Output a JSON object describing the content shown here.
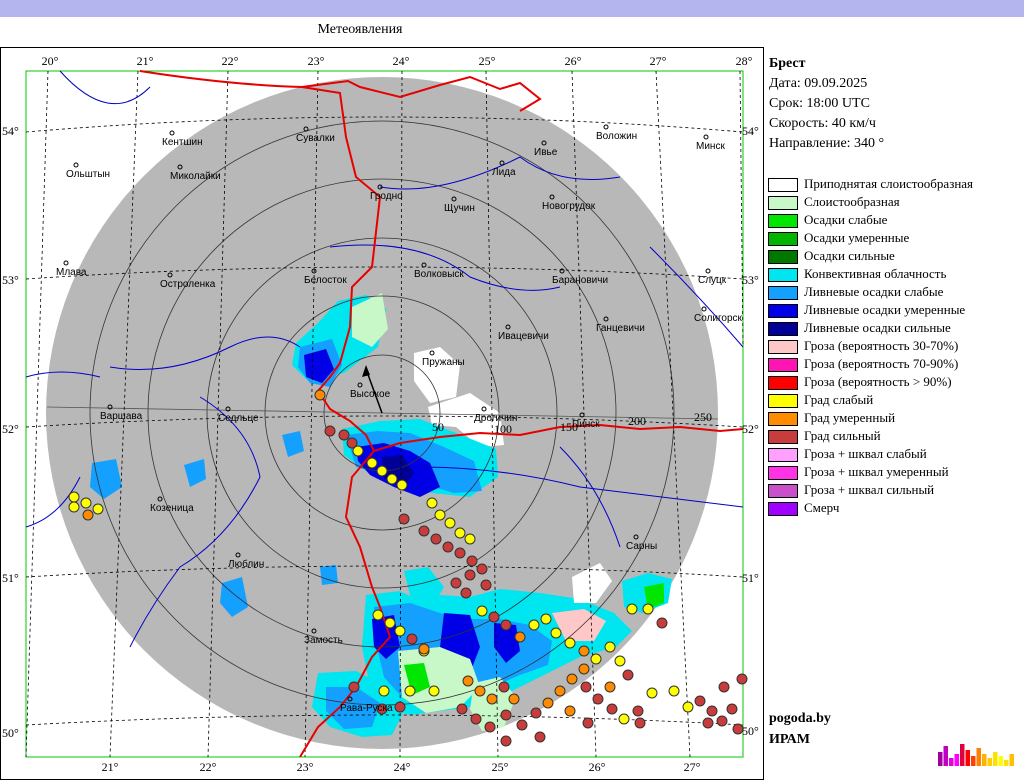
{
  "header": {
    "title": "Метеоявления"
  },
  "info": {
    "station": "Брест",
    "date": "Дата: 09.09.2025",
    "time": "Срок: 18:00 UTC",
    "speed": "Скорость: 40  км/ч",
    "direction": "Направление: 340 °"
  },
  "legend": [
    {
      "label": "Приподнятая слоистообразная",
      "color": "#ffffff"
    },
    {
      "label": "Слоистообразная",
      "color": "#c8f7c8"
    },
    {
      "label": "Осадки слабые",
      "color": "#00e600"
    },
    {
      "label": "Осадки умеренные",
      "color": "#00b400"
    },
    {
      "label": "Осадки сильные",
      "color": "#007800"
    },
    {
      "label": "Конвективная облачность",
      "color": "#00e6f0"
    },
    {
      "label": "Ливневые осадки слабые",
      "color": "#14a0ff"
    },
    {
      "label": "Ливневые осадки умеренные",
      "color": "#0000e6"
    },
    {
      "label": "Ливневые осадки сильные",
      "color": "#000096"
    },
    {
      "label": "Гроза (вероятность 30-70%)",
      "color": "#ffc8c8"
    },
    {
      "label": "Гроза (вероятность 70-90%)",
      "color": "#ff14b4"
    },
    {
      "label": "Гроза (вероятность > 90%)",
      "color": "#ff0000"
    },
    {
      "label": "Град слабый",
      "color": "#ffff00"
    },
    {
      "label": "Град умеренный",
      "color": "#ff8c00"
    },
    {
      "label": "Град сильный",
      "color": "#c83c3c"
    },
    {
      "label": "Гроза + шквал слабый",
      "color": "#ffa0ff"
    },
    {
      "label": "Гроза + шквал умеренный",
      "color": "#ff32e6"
    },
    {
      "label": "Гроза + шквал сильный",
      "color": "#c850c8"
    },
    {
      "label": "Смерч",
      "color": "#a000ff"
    }
  ],
  "credits": {
    "site": "pogoda.by",
    "org": "ИРАМ"
  },
  "map": {
    "lon_labels_top": [
      "20°",
      "21°",
      "22°",
      "23°",
      "24°",
      "25°",
      "26°",
      "27°",
      "28°"
    ],
    "lon_labels_bottom": [
      "21°",
      "22°",
      "23°",
      "24°",
      "25°",
      "26°",
      "27°"
    ],
    "lat_labels_left": [
      "54°",
      "53°",
      "52°",
      "51°",
      "50°"
    ],
    "lat_labels_right": [
      "54°",
      "53°",
      "52°",
      "51°",
      "50°"
    ],
    "range_labels": [
      "50",
      "100",
      "150",
      "200",
      "250"
    ],
    "cities": [
      "Сувалки",
      "Кентшин",
      "Ольштын",
      "Миколайки",
      "Гродно",
      "Лида",
      "Ивье",
      "Воложин",
      "Минск",
      "Щучин",
      "Новогрудок",
      "Белосток",
      "Волковыск",
      "Барановичи",
      "Слуцк",
      "Солигорск",
      "Млава",
      "Остроленка",
      "Ивацевичи",
      "Ганцевичи",
      "Пружаны",
      "Высокое",
      "Варшава",
      "Седльце",
      "Дрогичин",
      "Пинск",
      "Козеница",
      "Люблин",
      "Сарны",
      "Замость",
      "Рава-Руска"
    ]
  },
  "colors": {
    "radar_disk": "#b8b8b8",
    "border_red": "#e60000",
    "river_blue": "#0000c8",
    "map_frame_green": "#00c800"
  }
}
